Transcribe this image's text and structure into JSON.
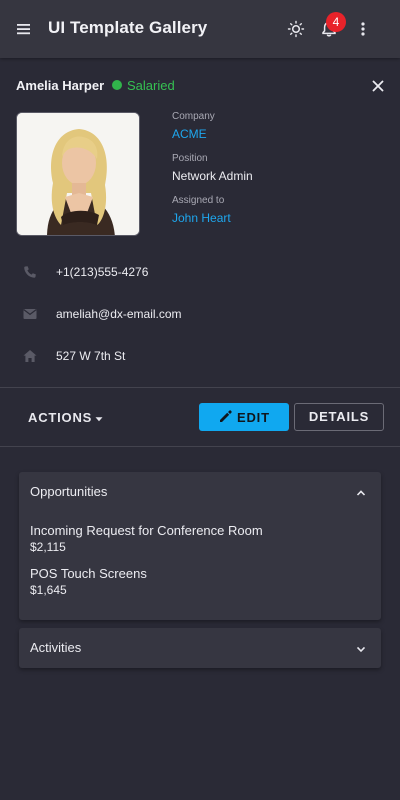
{
  "header": {
    "title": "UI Template Gallery",
    "notification_count": "4",
    "icons": {
      "menu": "menu-icon",
      "theme": "sun-icon",
      "notifications": "bell-icon",
      "more": "more-vert-icon"
    }
  },
  "contact": {
    "name": "Amelia Harper",
    "status": "Salaried",
    "status_color": "#35c152",
    "company_label": "Company",
    "company": "ACME",
    "position_label": "Position",
    "position": "Network Admin",
    "assigned_label": "Assigned to",
    "assigned_to": "John Heart",
    "phone": "+1(213)555-4276",
    "email": "ameliah@dx-email.com",
    "address": "527 W 7th St"
  },
  "actions": {
    "actions_label": "ACTIONS",
    "edit_label": "EDIT",
    "details_label": "DETAILS"
  },
  "opportunities": {
    "title": "Opportunities",
    "items": [
      {
        "name": "Incoming Request for Conference Room",
        "amount": "$2,115"
      },
      {
        "name": "POS Touch Screens",
        "amount": "$1,645"
      }
    ]
  },
  "activities": {
    "title": "Activities"
  },
  "colors": {
    "accent": "#10a8f0",
    "link": "#1ea7ee",
    "badge": "#e8232a",
    "background": "#2a2a36",
    "panel": "#363641"
  }
}
